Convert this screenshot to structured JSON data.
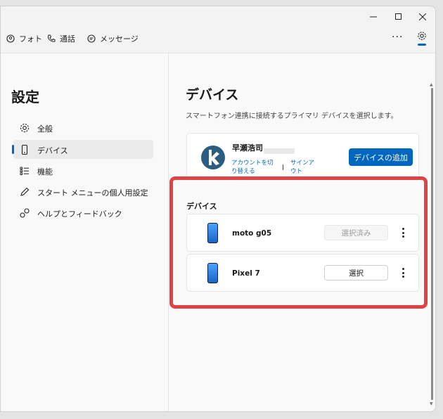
{
  "tabs": [
    {
      "label": "フォト",
      "icon": "photo-icon"
    },
    {
      "label": "通話",
      "icon": "phone-call-icon"
    },
    {
      "label": "メッセージ",
      "icon": "message-icon"
    }
  ],
  "more_label": "···",
  "sidebar": {
    "title": "設定",
    "items": [
      {
        "label": "全般",
        "icon": "gear-icon"
      },
      {
        "label": "デバイス",
        "icon": "phone-device-icon",
        "active": true
      },
      {
        "label": "機能",
        "icon": "feature-list-icon"
      },
      {
        "label": "スタート メニューの個人用設定",
        "icon": "pen-icon"
      },
      {
        "label": "ヘルプとフィードバック",
        "icon": "help-feedback-icon"
      }
    ]
  },
  "main": {
    "title": "デバイス",
    "description": "スマートフォン連携に接続するプライマリ デバイスを選択します。",
    "account": {
      "name": "早瀬浩司",
      "switch_account": "アカウントを切り替える",
      "sign_out": "サインアウト",
      "add_device": "デバイスの追加"
    },
    "devices_title": "デバイス",
    "devices": [
      {
        "name": "moto g05",
        "button": "選択済み",
        "disabled": true
      },
      {
        "name": "Pixel 7",
        "button": "選択",
        "disabled": false
      }
    ]
  },
  "colors": {
    "accent": "#0067c0",
    "highlight": "#e04343"
  }
}
